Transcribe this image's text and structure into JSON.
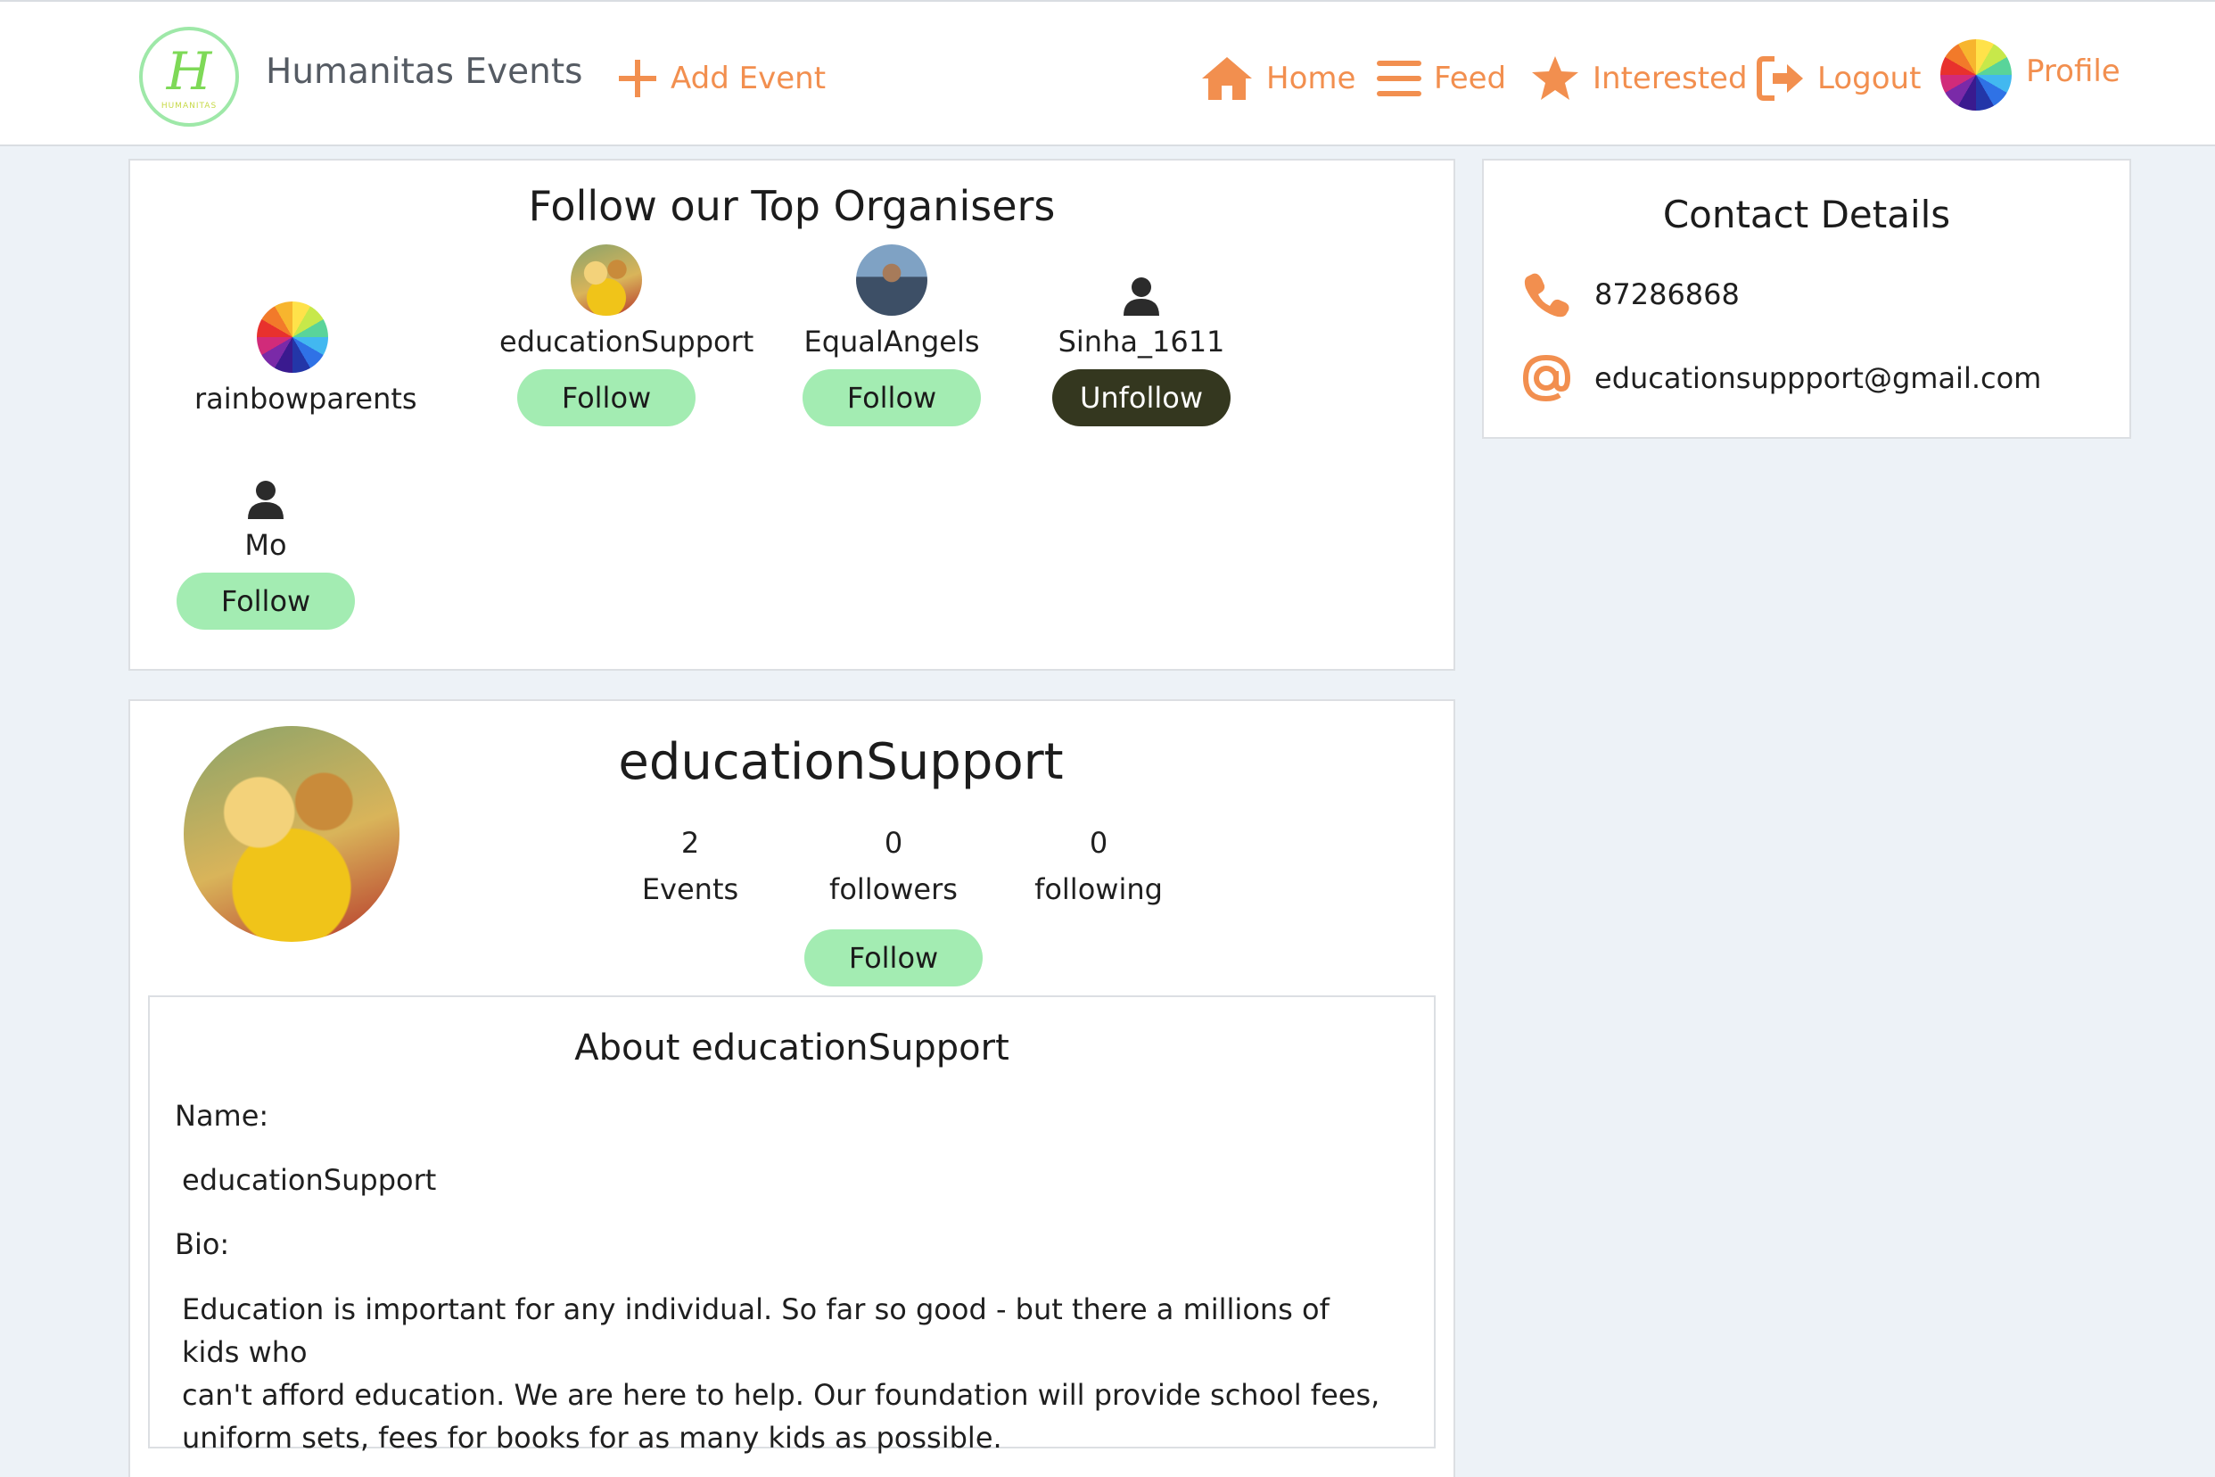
{
  "nav": {
    "brand": "Humanitas Events",
    "logo_letter": "H",
    "logo_small": "HUMANITAS",
    "add_event": "Add Event",
    "home": "Home",
    "feed": "Feed",
    "interested": "Interested",
    "logout": "Logout",
    "profile": "Profile"
  },
  "organisers": {
    "title": "Follow our Top Organisers",
    "items": [
      {
        "name": "rainbowparents",
        "avatar": "rainbow-avatar"
      },
      {
        "name": "educationSupport",
        "avatar": "photo-avatar",
        "button": "Follow"
      },
      {
        "name": "EqualAngels",
        "avatar": "photo-avatar",
        "button": "Follow"
      },
      {
        "name": "Sinha_1611",
        "avatar": "person-icon",
        "button": "Unfollow"
      },
      {
        "name": "Mo",
        "avatar": "person-icon",
        "button": "Follow"
      }
    ]
  },
  "contact": {
    "title": "Contact Details",
    "phone": "87286868",
    "email": "educationsuppport@gmail.com",
    "phone_icon": "phone-icon",
    "email_icon": "at-icon"
  },
  "profile": {
    "name": "educationSupport",
    "stats": [
      {
        "value": "2",
        "label": "Events"
      },
      {
        "value": "0",
        "label": "followers"
      },
      {
        "value": "0",
        "label": "following"
      }
    ],
    "follow_button": "Follow",
    "about": {
      "title": "About educationSupport",
      "name_label": "Name:",
      "name_value": "educationSupport",
      "bio_label": "Bio:",
      "bio_lines": [
        "Education is important for any individual. So far so good - but there a millions of kids who",
        "can't afford education. We are here to help. Our foundation will provide school fees,",
        "uniform sets, fees for books for as many kids as possible."
      ]
    }
  },
  "colors": {
    "accent": "#f28f4f",
    "follow_bg": "#a3ecb2",
    "unfollow_bg": "#34371f",
    "page_bg": "#edf2f7"
  }
}
